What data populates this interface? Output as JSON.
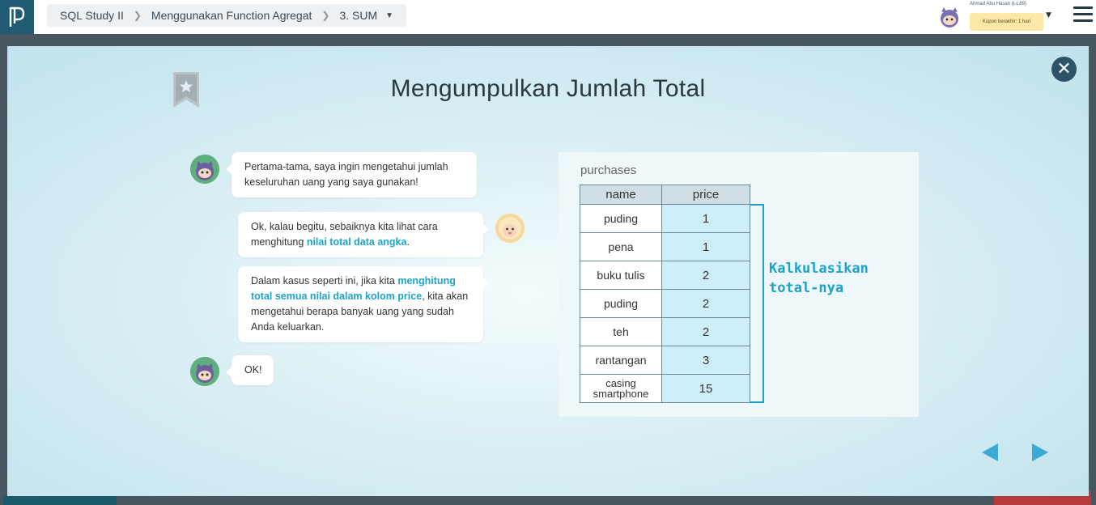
{
  "breadcrumb": {
    "items": [
      "SQL Study II",
      "Menggunakan Function Agregat",
      "3. SUM"
    ]
  },
  "user": {
    "name": "Ahmad Abu Hasan (Lv.89)",
    "coupon": "Kupon berakhir: 1 hari"
  },
  "slide": {
    "title": "Mengumpulkan Jumlah Total"
  },
  "chat": [
    {
      "speaker": "ninja",
      "side": "left",
      "text": "Pertama-tama, saya ingin mengetahui jumlah keseluruhan uang yang saya gunakan!"
    },
    {
      "speaker": "sheep",
      "side": "right",
      "text_before": "Ok, kalau begitu, sebaiknya kita lihat cara menghitung ",
      "highlight": "nilai total data angka",
      "text_after": "."
    },
    {
      "speaker": "sheep",
      "side": "right",
      "text_before": "Dalam kasus seperti ini, jika kita ",
      "highlight": "menghitung total semua nilai dalam kolom price",
      "text_after": ", kita akan mengetahui berapa banyak uang yang sudah Anda keluarkan."
    },
    {
      "speaker": "ninja",
      "side": "left",
      "text": "OK!"
    }
  ],
  "table": {
    "name": "purchases",
    "headers": [
      "name",
      "price"
    ],
    "rows": [
      [
        "puding",
        "1"
      ],
      [
        "pena",
        "1"
      ],
      [
        "buku tulis",
        "2"
      ],
      [
        "puding",
        "2"
      ],
      [
        "teh",
        "2"
      ],
      [
        "rantangan",
        "3"
      ],
      [
        "casing smartphone",
        "15"
      ]
    ]
  },
  "annotation": {
    "line1": "Kalkulasikan",
    "line2": "total-nya"
  },
  "colors": {
    "accent": "#1ba4c8",
    "logo_bg": "#1f5b73",
    "close_bg": "#2c5366",
    "nav_arrow": "#3aa9d6"
  }
}
